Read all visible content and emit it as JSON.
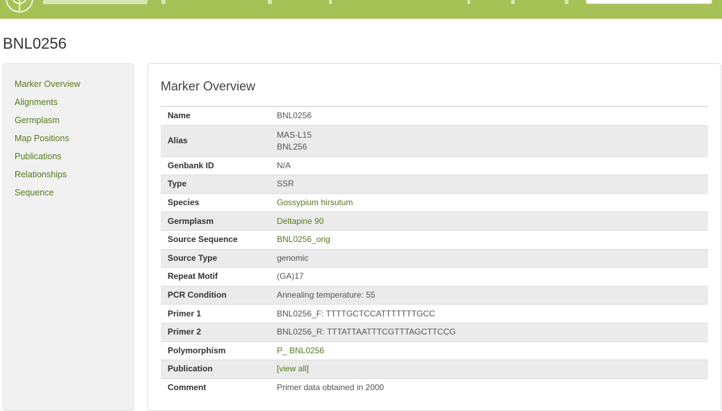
{
  "page": {
    "title": "BNL0256"
  },
  "sidebar": {
    "items": [
      {
        "label": "Marker Overview"
      },
      {
        "label": "Alignments"
      },
      {
        "label": "Germplasm"
      },
      {
        "label": "Map Positions"
      },
      {
        "label": "Publications"
      },
      {
        "label": "Relationships"
      },
      {
        "label": "Sequence"
      }
    ]
  },
  "panel": {
    "title": "Marker Overview",
    "rows": [
      {
        "label": "Name",
        "value": "BNL0256"
      },
      {
        "label": "Alias",
        "value_line1": "MAS-L15",
        "value_line2": "BNL256"
      },
      {
        "label": "Genbank ID",
        "value": "N/A"
      },
      {
        "label": "Type",
        "value": "SSR"
      },
      {
        "label": "Species",
        "value": "Gossypium hirsutum"
      },
      {
        "label": "Germplasm",
        "value": "Deltapine 90"
      },
      {
        "label": "Source Sequence",
        "value": "BNL0256_orig"
      },
      {
        "label": "Source Type",
        "value": "genomic"
      },
      {
        "label": "Repeat Motif",
        "value": "(GA)17"
      },
      {
        "label": "PCR Condition",
        "value": "Annealing temperature: 55"
      },
      {
        "label": "Primer 1",
        "value": "BNL0256_F: TTTTGCTCCATTTTTTTGCC"
      },
      {
        "label": "Primer 2",
        "value": "BNL0256_R: TTTATTAATTTCGTTTAGCTTCCG"
      },
      {
        "label": "Polymorphism",
        "value": "P_ BNL0256"
      },
      {
        "label": "Publication",
        "value": "[view all]"
      },
      {
        "label": "Comment",
        "value": "Primer data obtained in 2000"
      }
    ]
  },
  "colors": {
    "header": "#a6c257",
    "link": "#557a1f",
    "stripe": "#ebebeb",
    "sidebar_bg": "#f1f1f1"
  },
  "icons": {
    "logo": "globe-logo-icon"
  }
}
